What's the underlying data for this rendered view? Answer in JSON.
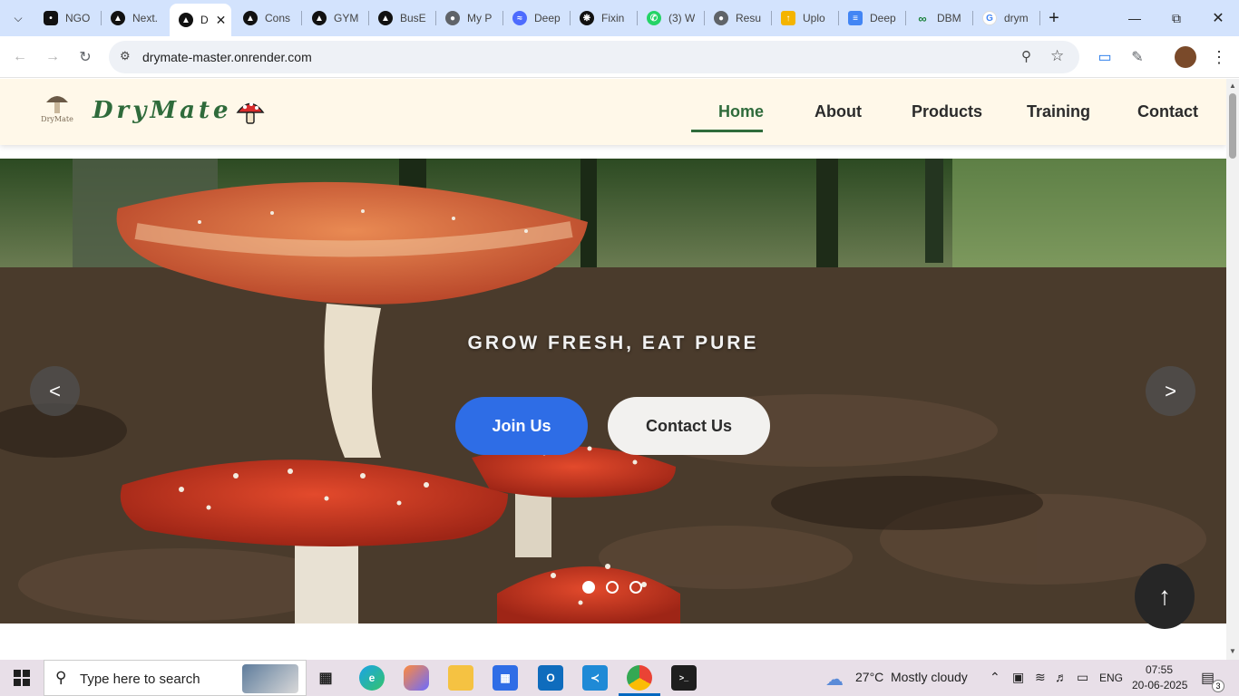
{
  "browser": {
    "tabs": [
      {
        "title": "NGO",
        "icon": "github-icon"
      },
      {
        "title": "Next.",
        "icon": "vercel-icon"
      },
      {
        "title": "D",
        "icon": "vercel-icon",
        "active": true
      },
      {
        "title": "Cons",
        "icon": "vercel-icon"
      },
      {
        "title": "GYM",
        "icon": "vercel-icon"
      },
      {
        "title": "BusE",
        "icon": "vercel-icon"
      },
      {
        "title": "My P",
        "icon": "globe-icon"
      },
      {
        "title": "Deep",
        "icon": "deepseek-icon"
      },
      {
        "title": "Fixin",
        "icon": "openai-icon"
      },
      {
        "title": "(3) W",
        "icon": "whatsapp-icon"
      },
      {
        "title": "Resu",
        "icon": "globe-icon"
      },
      {
        "title": "Uplo",
        "icon": "upload-icon"
      },
      {
        "title": "Deep",
        "icon": "docs-icon"
      },
      {
        "title": "DBM",
        "icon": "loop-icon"
      },
      {
        "title": "drym",
        "icon": "google-icon"
      }
    ],
    "url": "drymate-master.onrender.com"
  },
  "site": {
    "logo_badge": "DryMate",
    "brand": "DryMate",
    "nav": [
      "Home",
      "About",
      "Products",
      "Training",
      "Contact"
    ],
    "active_nav": "Home",
    "hero": {
      "tagline": "GROW FRESH, EAT PURE",
      "join_label": "Join Us",
      "contact_label": "Contact Us",
      "prev_label": "<",
      "next_label": ">",
      "slide_count": 3,
      "active_slide": 1
    }
  },
  "taskbar": {
    "search_placeholder": "Type here to search",
    "weather_temp": "27°C",
    "weather_desc": "Mostly cloudy",
    "lang": "ENG",
    "time": "07:55",
    "date": "20-06-2025",
    "notification_count": "3"
  },
  "colors": {
    "brand_green": "#2f6b3b",
    "header_bg": "#fff8e9",
    "join_button": "#2e6de6",
    "tab_strip": "#d3e3fd"
  }
}
